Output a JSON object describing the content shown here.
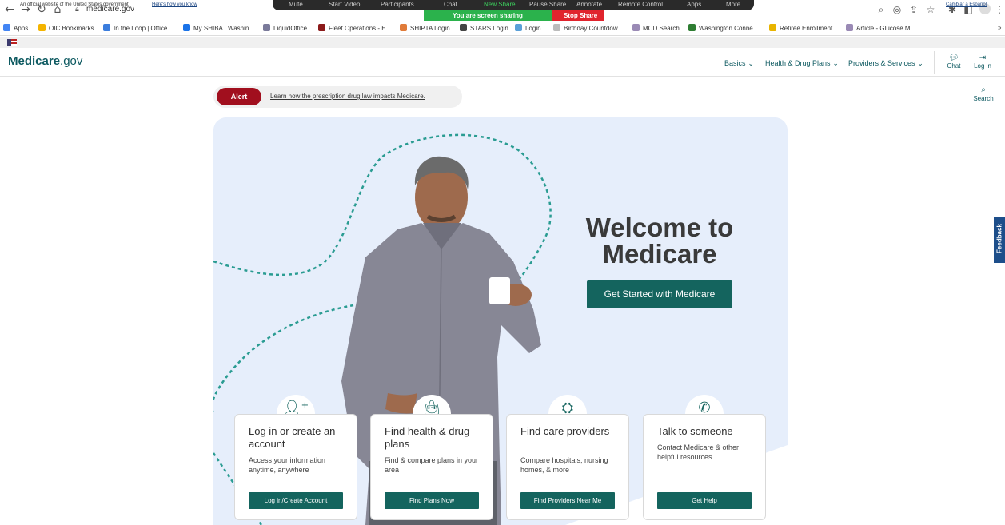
{
  "browser": {
    "url": "medicare.gov",
    "zoom_bar": [
      "Mute",
      "Start Video",
      "Participants",
      "Chat",
      "New Share",
      "Pause Share",
      "Annotate",
      "Remote Control",
      "Apps",
      "More"
    ],
    "sharing_text": "You are screen sharing",
    "stop_share": "Stop Share",
    "bookmarks": [
      {
        "label": "Apps",
        "color": "#4285f4"
      },
      {
        "label": "OIC Bookmarks",
        "color": "#f4b400"
      },
      {
        "label": "In the Loop | Office...",
        "color": "#3b7ddd"
      },
      {
        "label": "My SHIBA | Washin...",
        "color": "#1a73e8"
      },
      {
        "label": "LiquidOffice",
        "color": "#7a7a9a"
      },
      {
        "label": "Fleet Operations - E...",
        "color": "#8b1a1a"
      },
      {
        "label": "SHIPTA Login",
        "color": "#e07b39"
      },
      {
        "label": "STARS Login",
        "color": "#444444"
      },
      {
        "label": "Login",
        "color": "#5aa0d8"
      },
      {
        "label": "Birthday Countdow...",
        "color": "#bbbbbb"
      },
      {
        "label": "MCD Search",
        "color": "#9a8ab5"
      },
      {
        "label": "Washington Conne...",
        "color": "#2e7d32"
      },
      {
        "label": "Retiree Enrollment...",
        "color": "#e8b400"
      },
      {
        "label": "Article - Glucose M...",
        "color": "#9a8ab5"
      }
    ]
  },
  "gov_banner": {
    "text": "An official website of the United States government",
    "link": "Here's how you know",
    "espanol": "Cambiar a Español"
  },
  "header": {
    "logo_bold": "Medicare",
    "logo_rest": ".gov",
    "nav": [
      "Basics",
      "Health & Drug Plans",
      "Providers & Services"
    ],
    "chat": "Chat",
    "login": "Log in",
    "search": "Search"
  },
  "alert": {
    "pill": "Alert",
    "text": "Learn how the prescription drug law impacts Medicare."
  },
  "hero": {
    "welcome_line1": "Welcome to",
    "welcome_line2": "Medicare",
    "cta": "Get Started with Medicare"
  },
  "cards": [
    {
      "icon": "add-user-icon",
      "title": "Log in or create an account",
      "desc": "Access your information anytime, anywhere",
      "button": "Log in/Create Account"
    },
    {
      "icon": "shopping-bag-icon",
      "title": "Find health & drug plans",
      "desc": "Find & compare plans in your area",
      "button": "Find Plans Now"
    },
    {
      "icon": "binoculars-icon",
      "title": "Find care providers",
      "desc": "Compare hospitals, nursing homes, & more",
      "button": "Find Providers Near Me"
    },
    {
      "icon": "phone-icon",
      "title": "Talk to someone",
      "desc": "Contact Medicare & other helpful resources",
      "button": "Get Help"
    }
  ],
  "feedback": "Feedback",
  "colors": {
    "primary": "#14645e",
    "alert": "#a10f1e",
    "hero_bg": "#e6eefb",
    "text_dark": "#3a3a3a"
  }
}
